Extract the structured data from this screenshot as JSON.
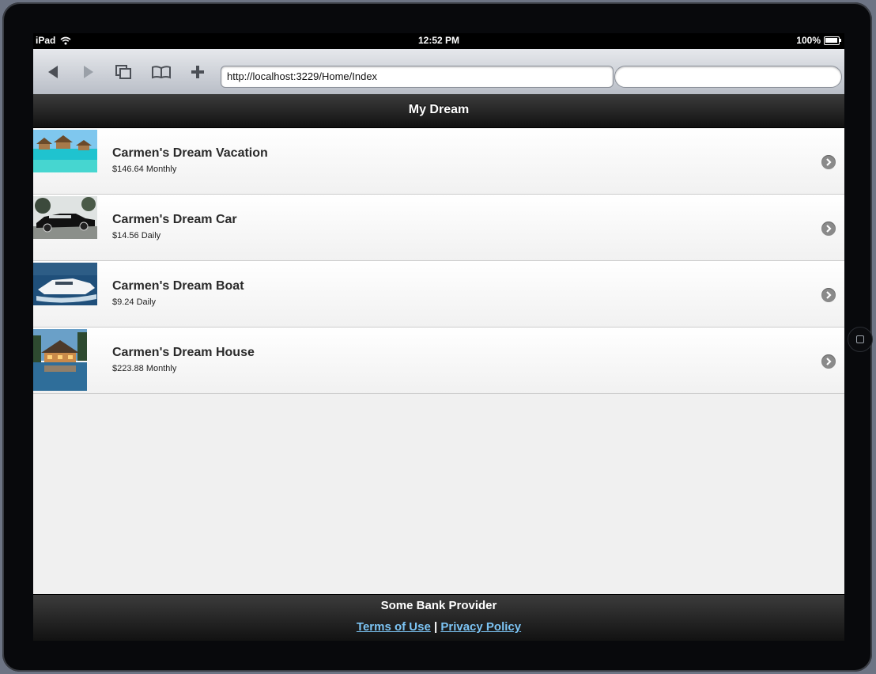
{
  "status_bar": {
    "device": "iPad",
    "time": "12:52 PM",
    "battery": "100%"
  },
  "browser": {
    "url": "http://localhost:3229/Home/Index",
    "search_placeholder": ""
  },
  "header": {
    "title": "My Dream"
  },
  "dreams": [
    {
      "title": "Carmen's Dream Vacation",
      "amount": "$146.64 Monthly",
      "icon": "vacation-photo"
    },
    {
      "title": "Carmen's Dream Car",
      "amount": "$14.56 Daily",
      "icon": "car-photo"
    },
    {
      "title": "Carmen's Dream Boat",
      "amount": "$9.24 Daily",
      "icon": "boat-photo"
    },
    {
      "title": "Carmen's Dream House",
      "amount": "$223.88 Monthly",
      "icon": "house-photo"
    }
  ],
  "footer": {
    "provider": "Some Bank Provider",
    "terms": "Terms of Use",
    "separator": "|",
    "privacy": "Privacy Policy"
  }
}
